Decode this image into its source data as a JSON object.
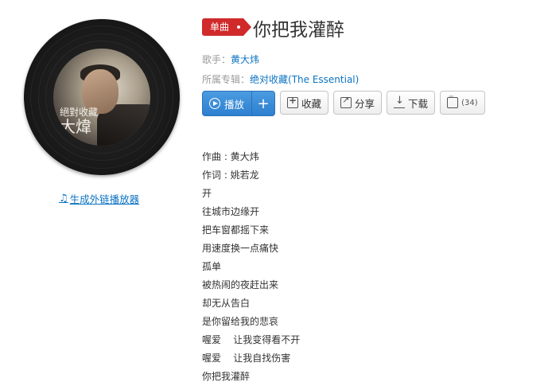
{
  "song": {
    "tag": "单曲",
    "title": "你把我灌醉",
    "singer_label": "歌手：",
    "singer": "黄大炜",
    "album_label": "所属专辑：",
    "album": "绝对收藏(The Essential)"
  },
  "cover": {
    "text_line1": "絕對收藏",
    "text_line2": "大煒"
  },
  "player_link": "生成外链播放器",
  "buttons": {
    "play": "播放",
    "add": "+",
    "favorite": "收藏",
    "share": "分享",
    "download": "下载",
    "comment_count": "(34)"
  },
  "lyrics": [
    "作曲 : 黄大炜",
    "作词 : 姚若龙",
    "开",
    "往城市边缘开",
    "把车窗都摇下来",
    "用速度换一点痛快",
    "孤单",
    "被热闹的夜赶出来",
    "却无从告白",
    "是你留给我的悲哀",
    "喔爱    让我变得看不开",
    "喔爱    让我自找伤害",
    "你把我灌醉"
  ],
  "colors": {
    "link_blue": "#0c73c2",
    "tag_red": "#d02a2a",
    "play_blue": "#2f80cf"
  }
}
